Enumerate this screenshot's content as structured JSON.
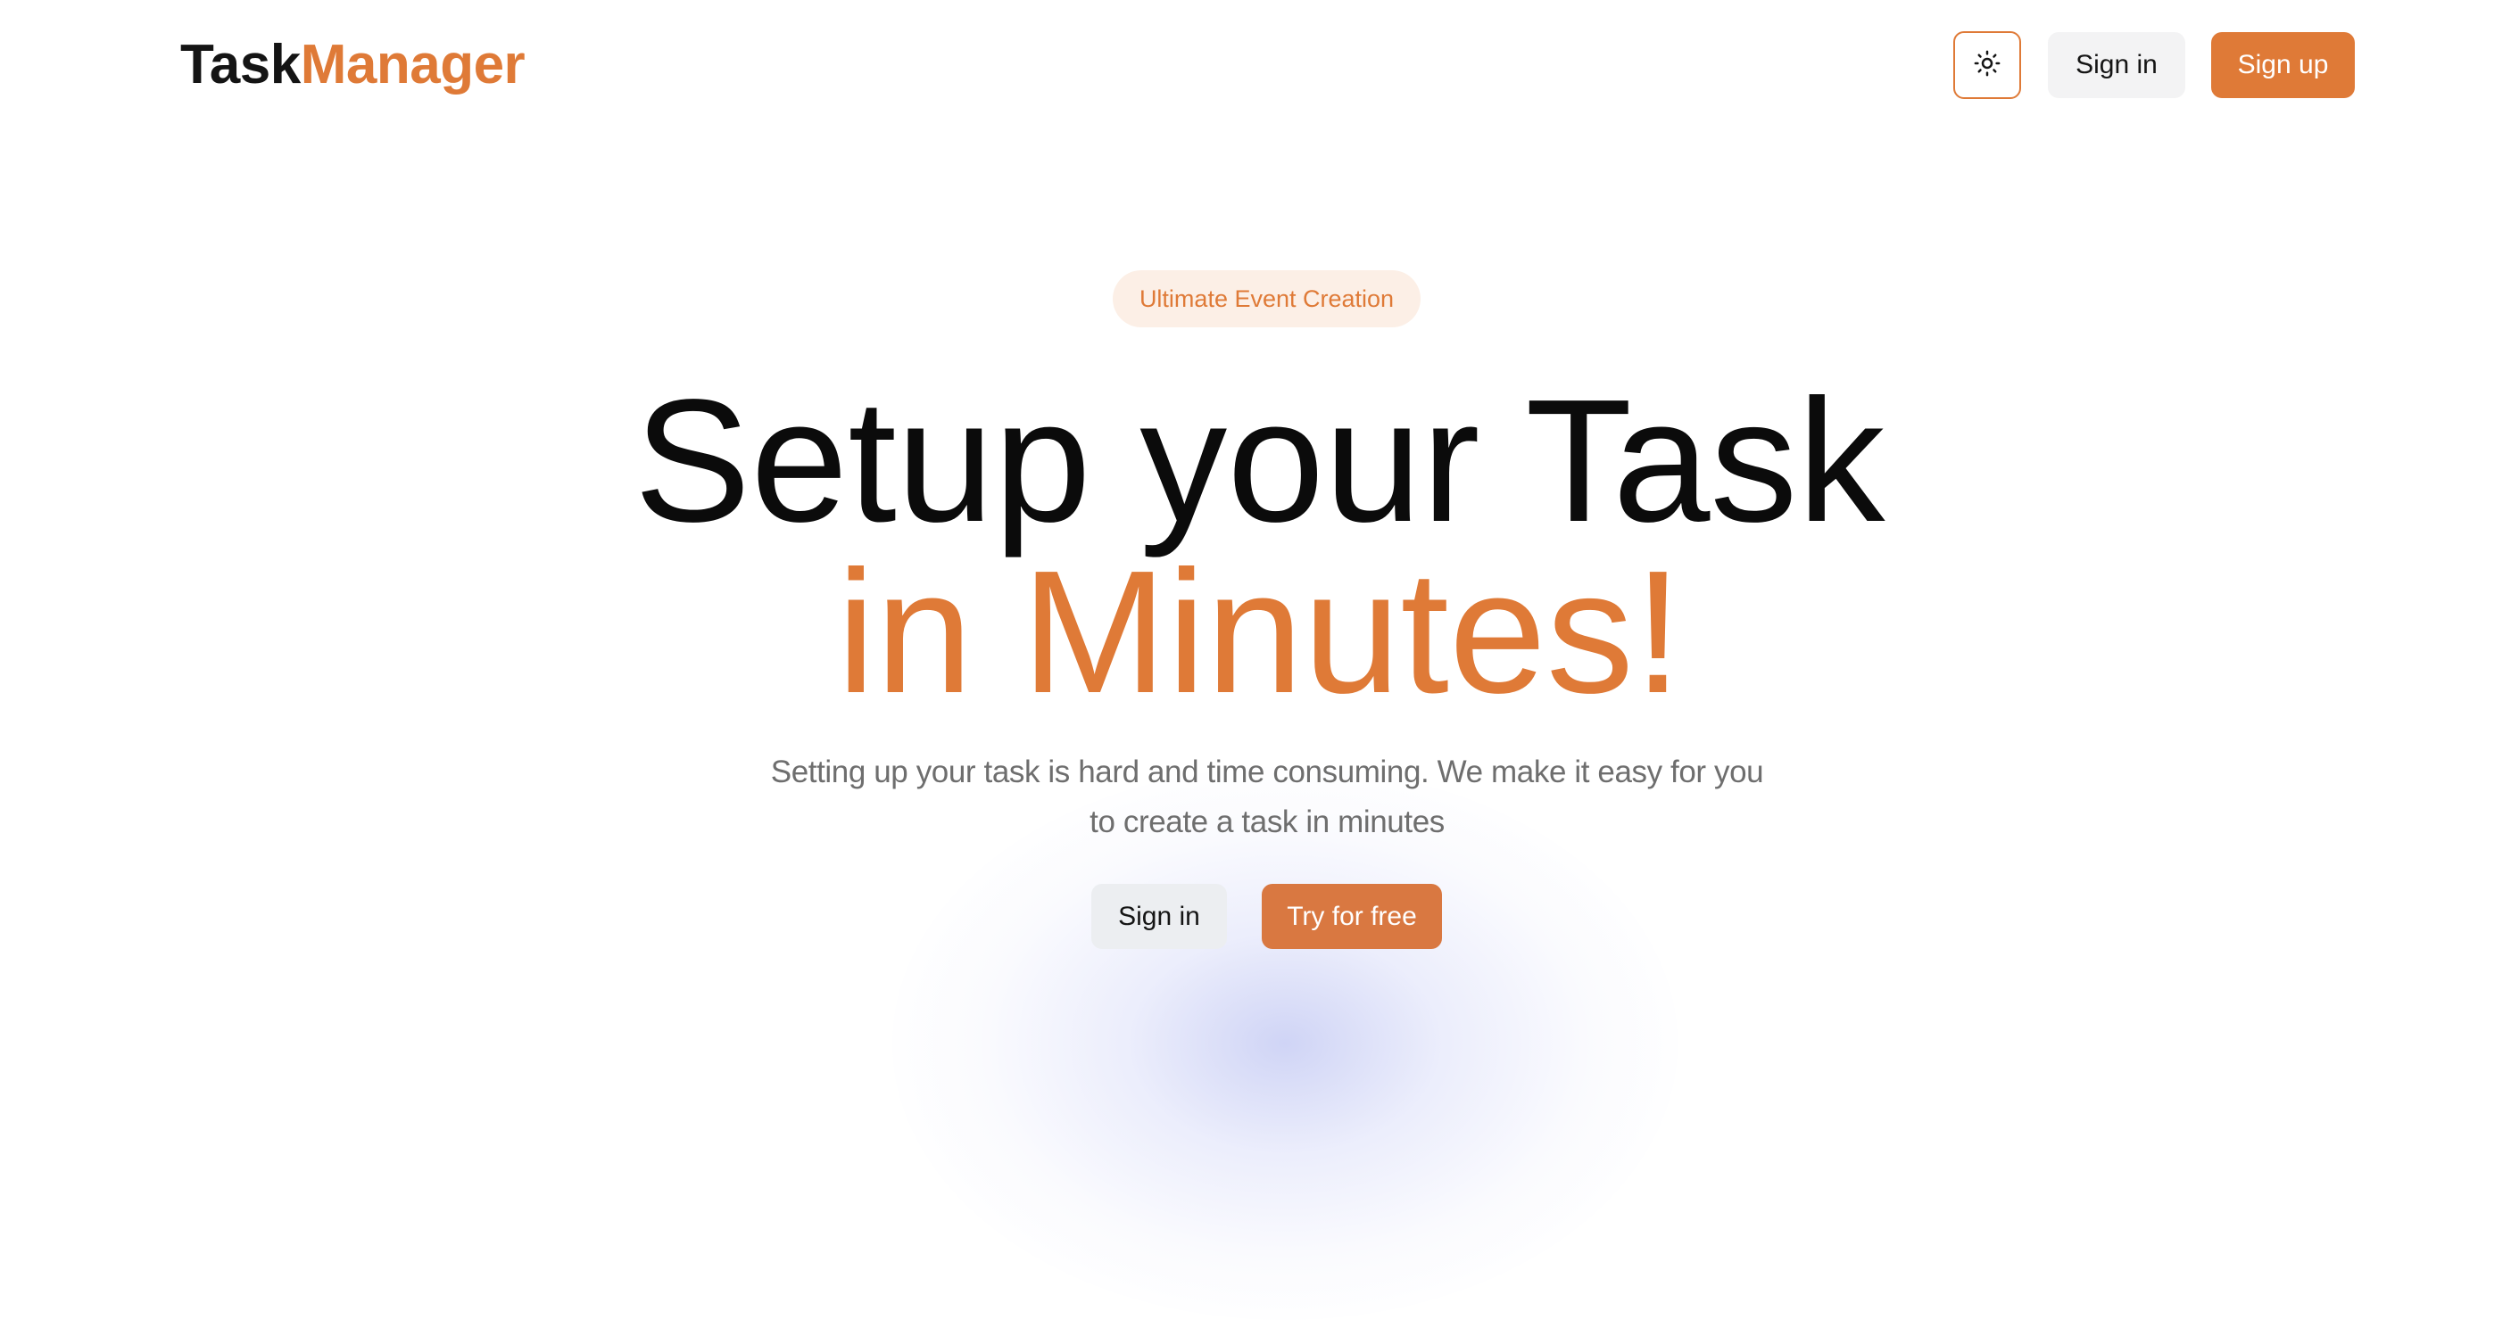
{
  "header": {
    "logo_part1": "Task",
    "logo_part2": "Manager",
    "theme_toggle_icon": "sun-icon",
    "signin_label": "Sign in",
    "signup_label": "Sign up"
  },
  "hero": {
    "badge": "Ultimate Event Creation",
    "title_line1": "Setup your Task",
    "title_line2": "in Minutes!",
    "subtitle": "Setting up your task is hard and time consuming. We make it easy for you to create a task in minutes",
    "signin_label": "Sign in",
    "try_label": "Try for free"
  },
  "colors": {
    "accent": "#df7a37",
    "text_dark": "#0b0b0b",
    "text_muted": "#6e6e6e",
    "badge_bg": "#fcefe6",
    "glow": "#cdd2f5"
  }
}
